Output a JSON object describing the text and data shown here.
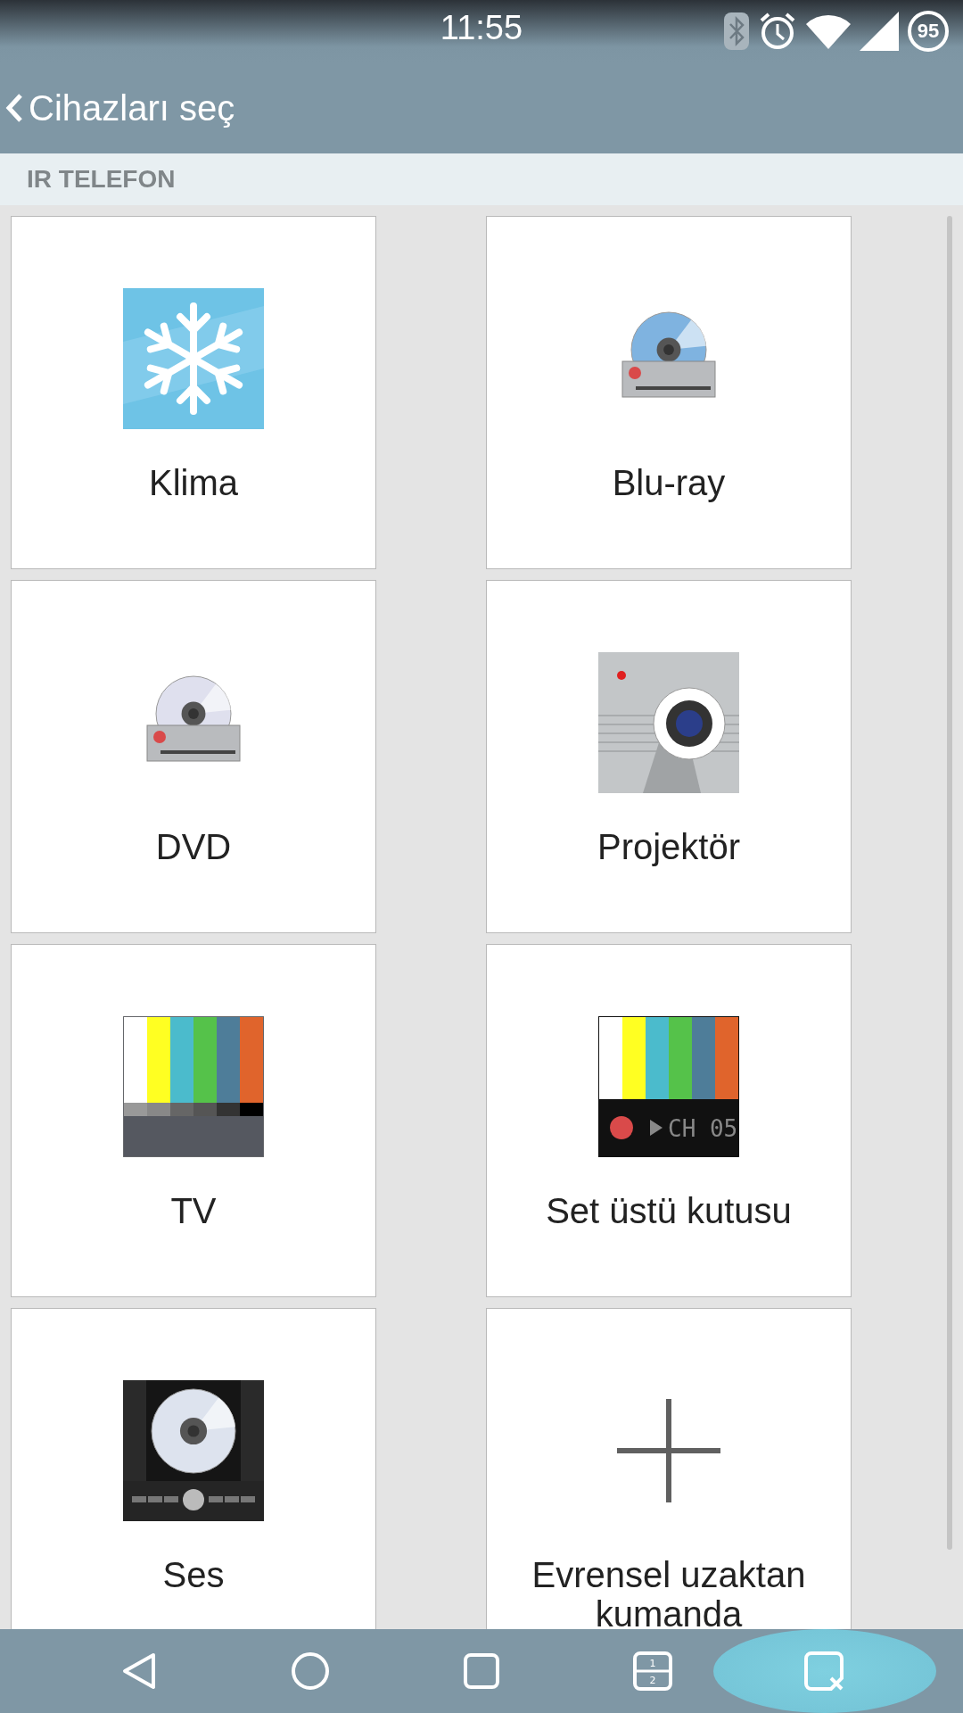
{
  "status_bar": {
    "time": "11:55",
    "battery": "95"
  },
  "app_bar": {
    "title": "Cihazları seç"
  },
  "section": {
    "title": "IR TELEFON"
  },
  "devices": [
    {
      "kind": "ac",
      "label": "Klima"
    },
    {
      "kind": "bluray",
      "label": "Blu-ray"
    },
    {
      "kind": "dvd",
      "label": "DVD"
    },
    {
      "kind": "projector",
      "label": "Projektör"
    },
    {
      "kind": "tv",
      "label": "TV"
    },
    {
      "kind": "settopbox",
      "label": "Set üstü kutusu"
    },
    {
      "kind": "audio",
      "label": "Ses"
    },
    {
      "kind": "add",
      "label": "Evrensel uzaktan kumanda"
    }
  ],
  "set_top_box_display": "CH 05",
  "nav_bar": {
    "dual_window_labels": [
      "1",
      "2"
    ]
  }
}
